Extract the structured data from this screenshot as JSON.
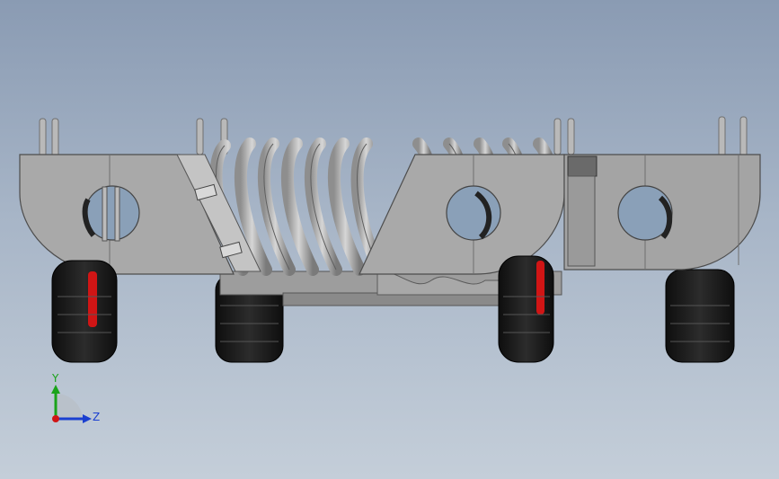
{
  "viewport": {
    "background_top": "#8a9bb3",
    "background_bottom": "#c4ced9"
  },
  "model": {
    "body_color": "#a9a9a9",
    "body_shade": "#8c8c8c",
    "tire_color": "#1c1c1c",
    "rim_accent": "#d01515",
    "pipe_color": "#b4b4b4"
  },
  "triad": {
    "y_label": "Y",
    "z_label": "Z",
    "y_color": "#1aa31a",
    "z_color": "#1a3fd0",
    "x_color": "#d01515"
  }
}
